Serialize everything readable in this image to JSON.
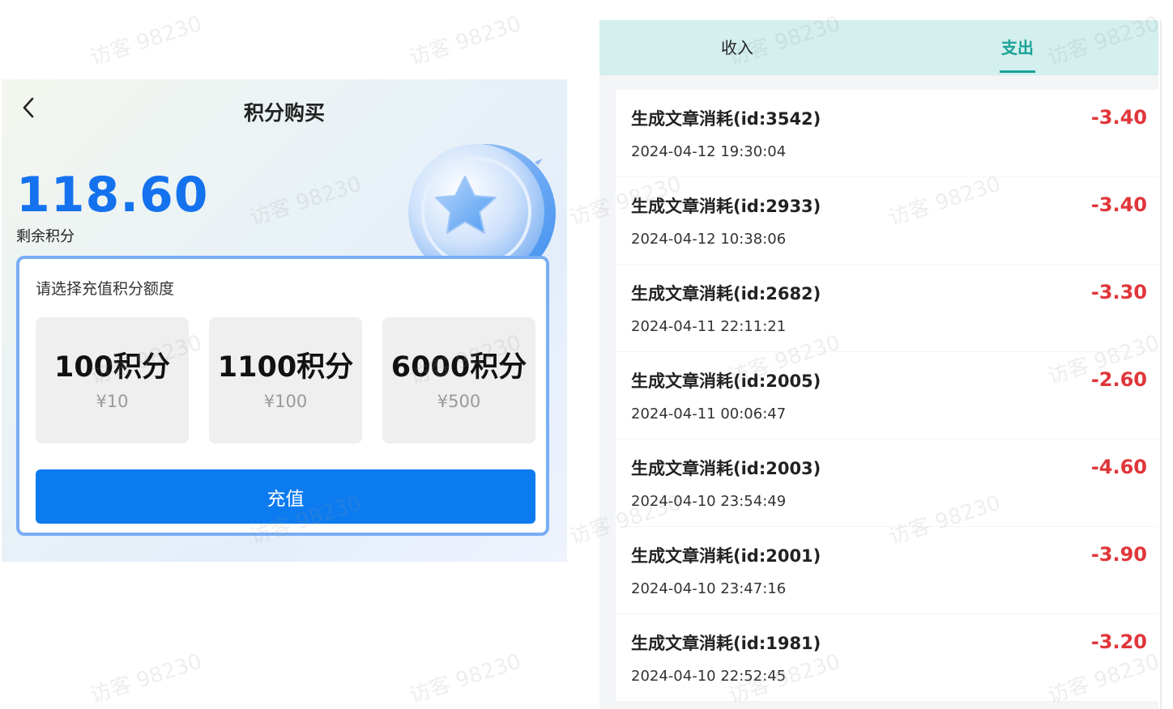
{
  "left": {
    "title": "积分购买",
    "balance": "118.60",
    "balance_label": "剩余积分",
    "hint": "请选择充值积分额度",
    "options": [
      {
        "points": "100积分",
        "price": "¥10"
      },
      {
        "points": "1100积分",
        "price": "¥100"
      },
      {
        "points": "6000积分",
        "price": "¥500"
      }
    ],
    "recharge_label": "充值"
  },
  "right": {
    "tabs": [
      "收入",
      "支出"
    ],
    "active_tab": "支出",
    "records": [
      {
        "title": "生成文章消耗(id:3542)",
        "time": "2024-04-12 19:30:04",
        "amount": "-3.40"
      },
      {
        "title": "生成文章消耗(id:2933)",
        "time": "2024-04-12 10:38:06",
        "amount": "-3.40"
      },
      {
        "title": "生成文章消耗(id:2682)",
        "time": "2024-04-11 22:11:21",
        "amount": "-3.30"
      },
      {
        "title": "生成文章消耗(id:2005)",
        "time": "2024-04-11 00:06:47",
        "amount": "-2.60"
      },
      {
        "title": "生成文章消耗(id:2003)",
        "time": "2024-04-10 23:54:49",
        "amount": "-4.60"
      },
      {
        "title": "生成文章消耗(id:2001)",
        "time": "2024-04-10 23:47:16",
        "amount": "-3.90"
      },
      {
        "title": "生成文章消耗(id:1981)",
        "time": "2024-04-10 22:52:45",
        "amount": "-3.20"
      }
    ]
  },
  "watermark": "访客 98230",
  "colors": {
    "accent_blue": "#0c7bf0",
    "balance_blue": "#1572ee",
    "tab_teal": "#1aa298",
    "tab_bg": "#d3efee",
    "amount_red": "#e0363a"
  },
  "icons": [
    "back-arrow-icon",
    "star-coin-icon"
  ]
}
